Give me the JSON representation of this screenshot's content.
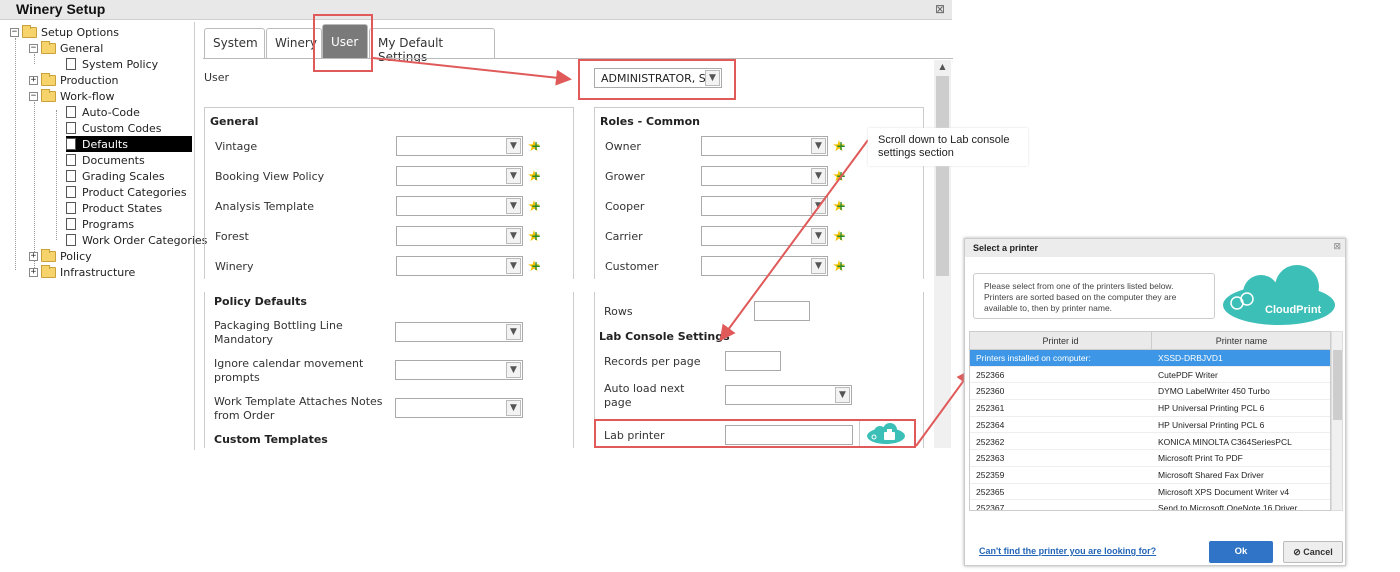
{
  "window": {
    "title": "Winery Setup"
  },
  "tree": {
    "root": "Setup Options",
    "general": "General",
    "system_policy": "System Policy",
    "production": "Production",
    "workflow": "Work-flow",
    "workflow_items": [
      "Auto-Code",
      "Custom Codes",
      "Defaults",
      "Documents",
      "Grading Scales",
      "Product Categories",
      "Product States",
      "Programs",
      "Work Order Categories"
    ],
    "policy": "Policy",
    "infrastructure": "Infrastructure"
  },
  "tabs": [
    "System",
    "Winery",
    "User",
    "My Default Settings"
  ],
  "user": {
    "label": "User",
    "value": "ADMINISTRATOR, S"
  },
  "general": {
    "header": "General",
    "fields": [
      "Vintage",
      "Booking View Policy",
      "Analysis Template",
      "Forest",
      "Winery"
    ]
  },
  "roles": {
    "header": "Roles - Common",
    "fields": [
      "Owner",
      "Grower",
      "Cooper",
      "Carrier",
      "Customer"
    ]
  },
  "policy_defaults": {
    "header": "Policy Defaults",
    "fields": [
      "Packaging Bottling Line Mandatory",
      "Ignore calendar movement prompts",
      "Work Template Attaches Notes from Order"
    ],
    "custom_templates": "Custom Templates"
  },
  "lab": {
    "rows_label": "Rows",
    "header": "Lab Console Settings",
    "records_label": "Records per page",
    "autoload_label": "Auto load next page",
    "printer_label": "Lab printer"
  },
  "callout": "Scroll down to Lab console settings section",
  "dialog": {
    "title": "Select a printer",
    "info": "Please select from one of the printers listed below. Printers are sorted based on the computer they are available to, then by printer name.",
    "logo": "CloudPrint",
    "col_id": "Printer id",
    "col_name": "Printer name",
    "rows": [
      {
        "id": "Printers installed on computer:",
        "name": "XSSD-DRBJVD1"
      },
      {
        "id": "252366",
        "name": "CutePDF Writer"
      },
      {
        "id": "252360",
        "name": "DYMO LabelWriter 450 Turbo"
      },
      {
        "id": "252361",
        "name": "HP Universal Printing PCL 6"
      },
      {
        "id": "252364",
        "name": "HP Universal Printing PCL 6"
      },
      {
        "id": "252362",
        "name": "KONICA MINOLTA C364SeriesPCL"
      },
      {
        "id": "252363",
        "name": "Microsoft Print To PDF"
      },
      {
        "id": "252359",
        "name": "Microsoft Shared Fax Driver"
      },
      {
        "id": "252365",
        "name": "Microsoft XPS Document Writer v4"
      },
      {
        "id": "252367",
        "name": "Send to Microsoft OneNote 16 Driver"
      }
    ],
    "link": "Can't find the printer you are looking for?",
    "ok": "Ok",
    "cancel": "Cancel"
  },
  "colors": {
    "annotation": "#e05a5a",
    "selection": "#3d97e6",
    "ok_button": "#2f74c6",
    "cloud": "#3bbfb7"
  }
}
